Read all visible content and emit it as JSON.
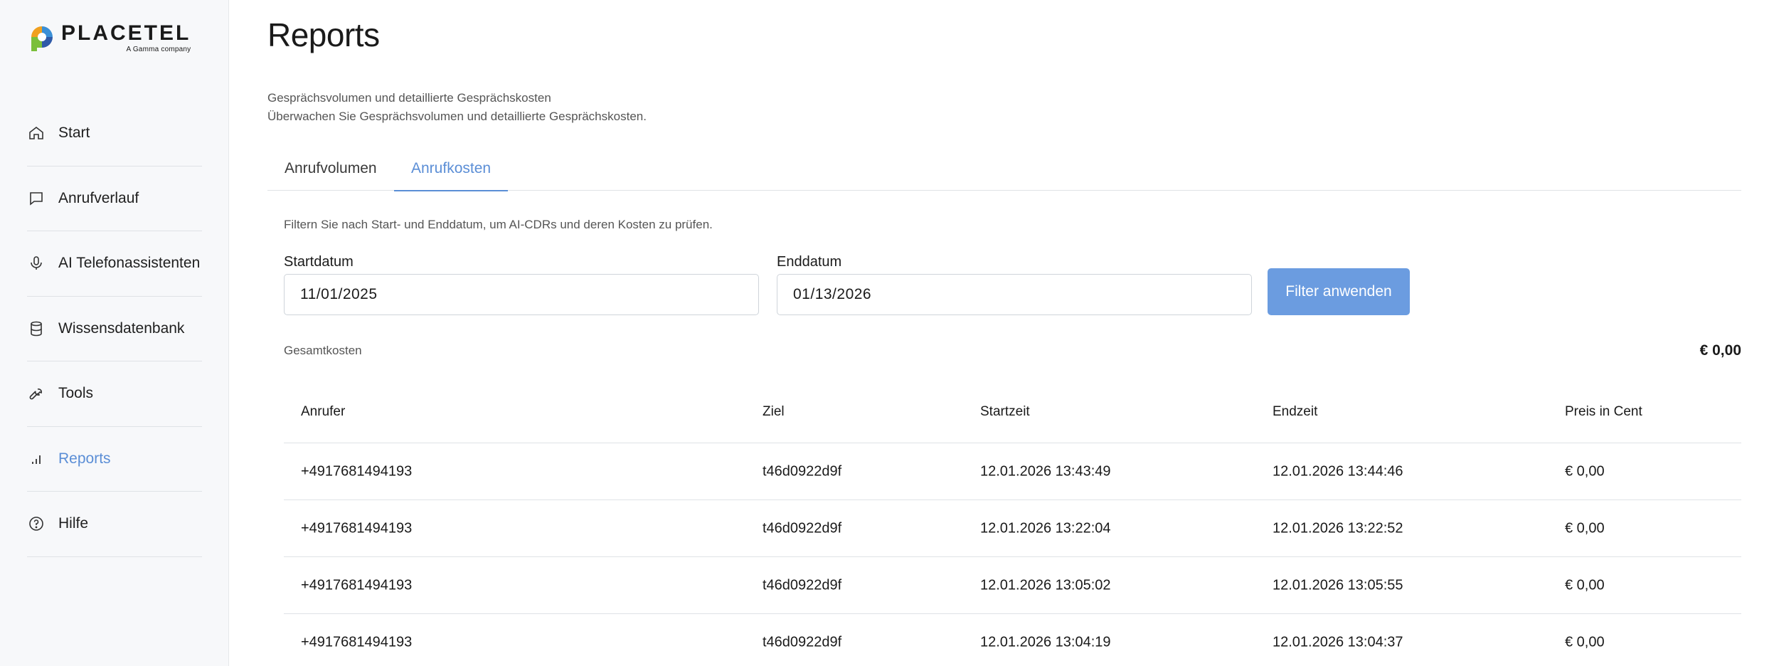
{
  "logo": {
    "word": "PLACETEL",
    "sub": "A Gamma company"
  },
  "sidebar": {
    "items": [
      {
        "label": "Start",
        "icon": "home-icon"
      },
      {
        "label": "Anrufverlauf",
        "icon": "chat-icon"
      },
      {
        "label": "AI Telefonassistenten",
        "icon": "microphone-icon"
      },
      {
        "label": "Wissensdatenbank",
        "icon": "database-icon"
      },
      {
        "label": "Tools",
        "icon": "wrench-icon"
      },
      {
        "label": "Reports",
        "icon": "bar-chart-icon",
        "active": true
      },
      {
        "label": "Hilfe",
        "icon": "help-circle-icon"
      }
    ]
  },
  "page": {
    "title": "Reports",
    "subtitle_line1": "Gesprächsvolumen und detaillierte Gesprächskosten",
    "subtitle_line2": "Überwachen Sie Gesprächsvolumen und detaillierte Gesprächskosten."
  },
  "tabs": [
    {
      "label": "Anrufvolumen"
    },
    {
      "label": "Anrufkosten",
      "active": true
    }
  ],
  "filter": {
    "hint": "Filtern Sie nach Start- und Enddatum, um AI-CDRs und deren Kosten zu prüfen.",
    "start_label": "Startdatum",
    "start_value": "11/01/2025",
    "end_label": "Enddatum",
    "end_value": "01/13/2026",
    "apply_label": "Filter anwenden"
  },
  "total": {
    "label": "Gesamtkosten",
    "value": "€ 0,00"
  },
  "table": {
    "headers": [
      "Anrufer",
      "Ziel",
      "Startzeit",
      "Endzeit",
      "Preis in Cent"
    ],
    "rows": [
      [
        "+4917681494193",
        "t46d0922d9f",
        "12.01.2026 13:43:49",
        "12.01.2026 13:44:46",
        "€ 0,00"
      ],
      [
        "+4917681494193",
        "t46d0922d9f",
        "12.01.2026 13:22:04",
        "12.01.2026 13:22:52",
        "€ 0,00"
      ],
      [
        "+4917681494193",
        "t46d0922d9f",
        "12.01.2026 13:05:02",
        "12.01.2026 13:05:55",
        "€ 0,00"
      ],
      [
        "+4917681494193",
        "t46d0922d9f",
        "12.01.2026 13:04:19",
        "12.01.2026 13:04:37",
        "€ 0,00"
      ]
    ]
  },
  "colors": {
    "accent": "#5b8ed6",
    "button": "#6b9ce0"
  }
}
